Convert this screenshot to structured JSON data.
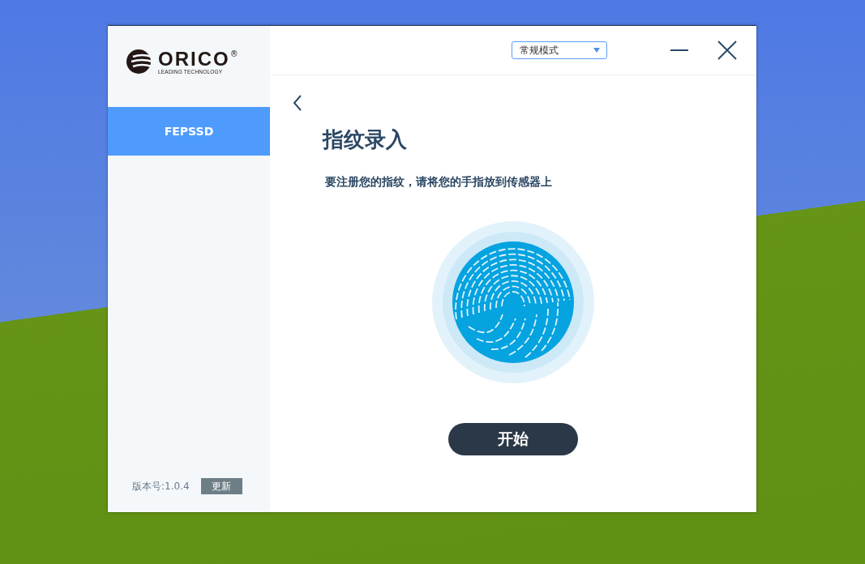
{
  "logo": {
    "name": "ORICO",
    "mark": "®",
    "tagline": "LEADING TECHNOLOGY"
  },
  "sidebar": {
    "items": [
      {
        "label": "FEPSSD",
        "selected": true
      }
    ],
    "version": "版本号:1.0.4",
    "update_button": "更新"
  },
  "header": {
    "mode_select": {
      "value": "常规模式"
    }
  },
  "page": {
    "title": "指纹录入",
    "instruction": "要注册您的指纹，请将您的手指放到传感器上",
    "start_button": "开始"
  }
}
